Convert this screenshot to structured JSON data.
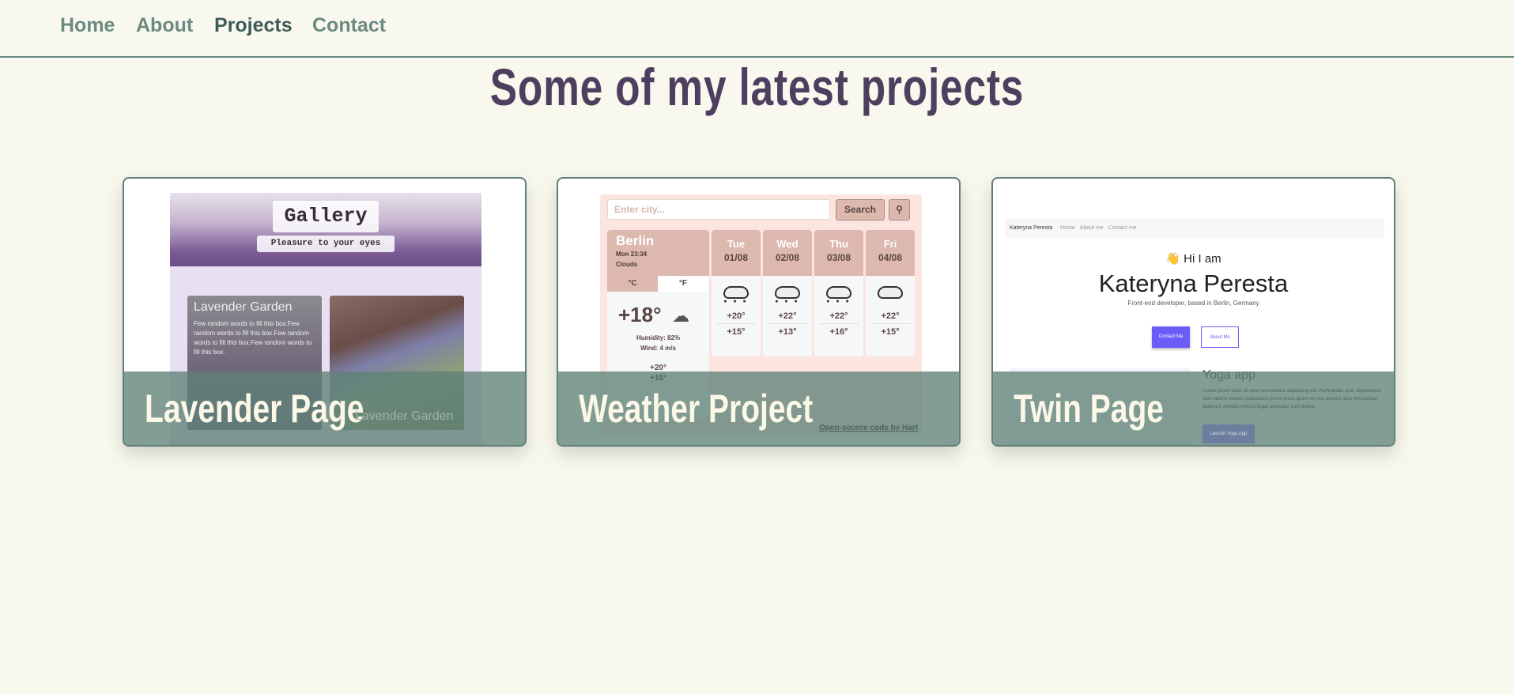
{
  "nav": {
    "items": [
      {
        "label": "Home",
        "active": false
      },
      {
        "label": "About",
        "active": false
      },
      {
        "label": "Projects",
        "active": true
      },
      {
        "label": "Contact",
        "active": false
      }
    ]
  },
  "heading": "Some of my latest projects",
  "colors": {
    "nav": "#6b8a80",
    "nav_active": "#3e5c57",
    "heading": "#4e3f5f",
    "overlay": "#5f8276",
    "background": "#f9f8ef"
  },
  "projects": [
    {
      "title": "Lavender Page",
      "preview": {
        "gallery_title": "Gallery",
        "gallery_subtitle": "Pleasure to your eyes",
        "box_title": "Lavender Garden",
        "box_text": "Few random words to fill this box.Few random words to fill this box.Few random words to fill this box.Few random words to fill this box.",
        "image_caption": "Lavender Garden"
      }
    },
    {
      "title": "Weather Project",
      "preview": {
        "search_placeholder": "Enter city...",
        "search_label": "Search",
        "pin_icon": "map-pin-icon",
        "city": "Berlin",
        "datetime": "Mon 23:34",
        "condition": "Clouds",
        "unit_c": "°C",
        "unit_f": "°F",
        "current_temp": "+18°",
        "humidity": "Humidity: 82%",
        "wind": "Wind: 4 m/s",
        "today_high": "+20°",
        "today_low": "+15°",
        "footer_link": "Open-source code by Hart",
        "days": [
          {
            "day": "Tue",
            "date": "01/08",
            "high": "+20°",
            "low": "+15°",
            "rain": true
          },
          {
            "day": "Wed",
            "date": "02/08",
            "high": "+22°",
            "low": "+13°",
            "rain": true
          },
          {
            "day": "Thu",
            "date": "03/08",
            "high": "+22°",
            "low": "+16°",
            "rain": true
          },
          {
            "day": "Fri",
            "date": "04/08",
            "high": "+22°",
            "low": "+15°",
            "rain": false
          }
        ]
      }
    },
    {
      "title": "Twin Page",
      "preview": {
        "brand": "Kateryna Peresta",
        "nav": [
          "Home",
          "About me",
          "Contact me"
        ],
        "greeting": "👋 Hi I am",
        "name": "Kateryna Peresta",
        "tagline": "Front-end developer, based in Berlin, Germany",
        "contact_btn": "Contact Me",
        "about_btn": "About Me",
        "section_title": "Yoga app",
        "section_text": "Lorem ipsum dolor sit amet consectetur adipisicing elit. Perferendis quia, dignissimos nam ratione veniam quibusdam porro omnis quam vel eos eveniet alias temporibus deserunt veritatis minima fugiat explicabo eum dolore.",
        "launch_btn": "Launch Yoga App"
      }
    }
  ]
}
